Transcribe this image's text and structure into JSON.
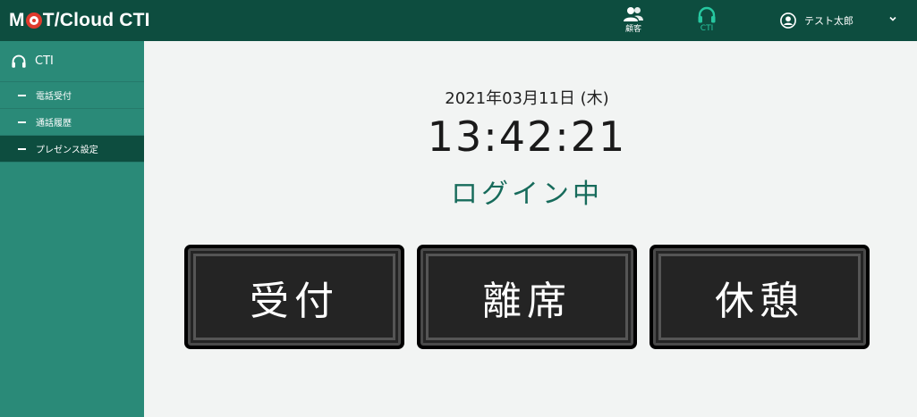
{
  "app": {
    "logo_text_prefix": "M",
    "logo_text_suffix": "T/Cloud CTI"
  },
  "header": {
    "nav": [
      {
        "label": "顧客",
        "icon": "people-icon"
      },
      {
        "label": "CTI",
        "icon": "headset-icon"
      }
    ],
    "user": {
      "name": "テスト太郎",
      "icon": "user-circle-icon"
    }
  },
  "sidebar": {
    "section_title": "CTI",
    "items": [
      {
        "label": "電話受付"
      },
      {
        "label": "通話履歴"
      },
      {
        "label": "プレゼンス設定",
        "active": true
      }
    ]
  },
  "main": {
    "date": "2021年03月11日 (木)",
    "time": "13:42:21",
    "status": "ログイン中",
    "buttons": [
      {
        "label": "受付"
      },
      {
        "label": "離席"
      },
      {
        "label": "休憩"
      }
    ]
  },
  "colors": {
    "header_bg": "#0d4d3f",
    "sidebar_bg": "#2a8a78",
    "accent": "#27c7a0",
    "status_text": "#176b5b"
  }
}
